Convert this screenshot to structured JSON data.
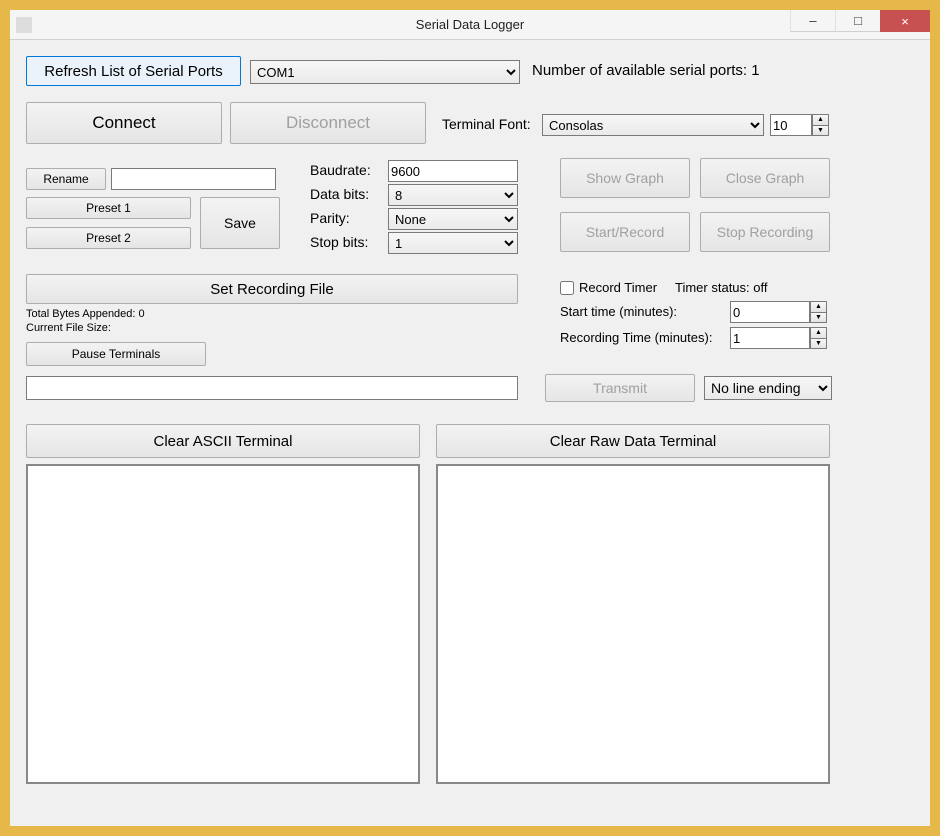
{
  "window": {
    "title": "Serial Data Logger",
    "minimize": "–",
    "maximize": "□",
    "close": "×"
  },
  "topbar": {
    "refresh_label": "Refresh List of Serial Ports",
    "port_select": "COM1",
    "ports_count_label": "Number of available serial ports: 1"
  },
  "conn": {
    "connect_label": "Connect",
    "disconnect_label": "Disconnect",
    "font_label": "Terminal Font:",
    "font_select": "Consolas",
    "font_size": "10"
  },
  "preset": {
    "rename_label": "Rename",
    "rename_value": "",
    "preset1_label": "Preset 1",
    "preset2_label": "Preset 2",
    "save_label": "Save"
  },
  "serial": {
    "baud_label": "Baudrate:",
    "baud_value": "9600",
    "databits_label": "Data bits:",
    "databits_value": "8",
    "parity_label": "Parity:",
    "parity_value": "None",
    "stopbits_label": "Stop bits:",
    "stopbits_value": "1"
  },
  "graph": {
    "show_label": "Show Graph",
    "close_label": "Close Graph",
    "start_label": "Start/Record",
    "stop_label": "Stop Recording"
  },
  "recfile": {
    "set_label": "Set Recording File",
    "bytes_label": "Total Bytes Appended: 0",
    "size_label": "Current File Size:",
    "pause_label": "Pause Terminals"
  },
  "timer": {
    "record_timer_label": "Record Timer",
    "status_label": "Timer status: off",
    "start_time_label": "Start time (minutes):",
    "start_time_value": "0",
    "rec_time_label": "Recording Time (minutes):",
    "rec_time_value": "1"
  },
  "tx": {
    "input_value": "",
    "transmit_label": "Transmit",
    "line_ending": "No line ending"
  },
  "terms": {
    "clear_ascii_label": "Clear ASCII Terminal",
    "clear_raw_label": "Clear Raw Data Terminal"
  }
}
